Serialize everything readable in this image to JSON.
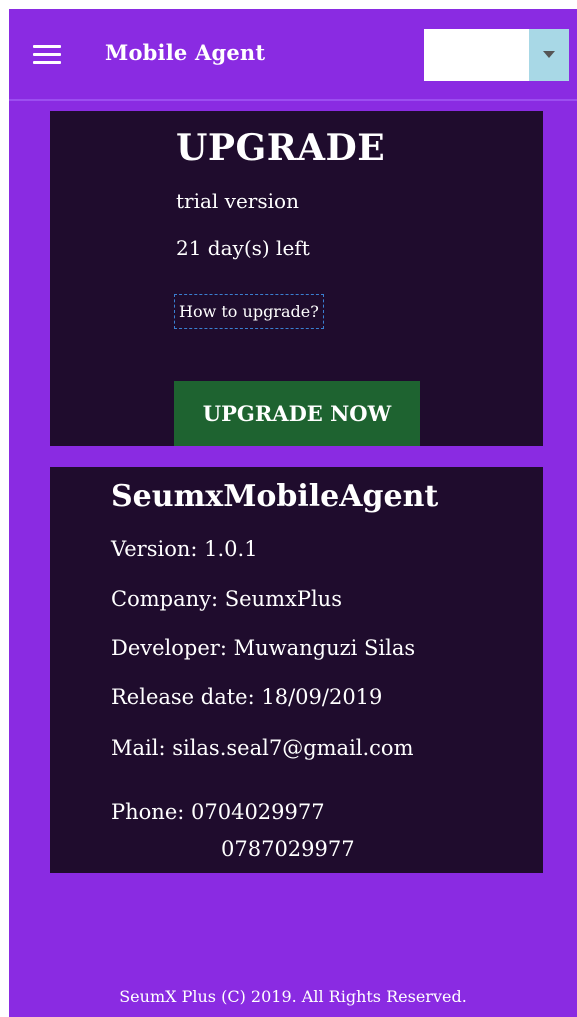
{
  "header": {
    "title": "Mobile Agent",
    "menu_icon": "hamburger-menu-icon",
    "select": {
      "value": "",
      "arrow_icon": "caret-down-icon"
    }
  },
  "upgrade": {
    "title": "UPGRADE",
    "trial_label": "trial version",
    "days_left": "21 day(s) left",
    "howto_link": "How to upgrade?",
    "button_label": "UPGRADE NOW"
  },
  "about": {
    "app_name": "SeumxMobileAgent",
    "version": "Version: 1.0.1",
    "company": "Company: SeumxPlus",
    "developer": "Developer: Muwanguzi Silas",
    "release_date": "Release date: 18/09/2019",
    "mail": "Mail: silas.seal7@gmail.com",
    "phone_1": "Phone: 0704029977",
    "phone_2": "0787029977"
  },
  "footer": {
    "text": "SeumX Plus (C) 2019. All Rights Reserved."
  },
  "colors": {
    "background": "#8a2be2",
    "card": "#1f0c2d",
    "button": "#1e6330",
    "select_arrow": "#a8d8e6"
  }
}
